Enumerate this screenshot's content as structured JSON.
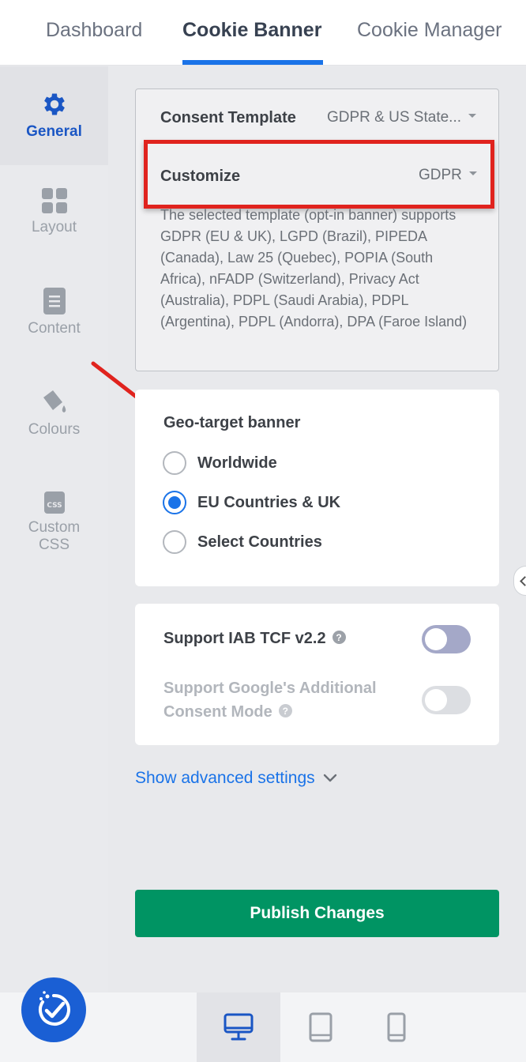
{
  "tabs": [
    {
      "label": "Dashboard",
      "active": false
    },
    {
      "label": "Cookie Banner",
      "active": true
    },
    {
      "label": "Cookie Manager",
      "active": false
    }
  ],
  "sidebar": {
    "items": [
      {
        "label": "General",
        "icon": "gear-icon",
        "active": true
      },
      {
        "label": "Layout",
        "icon": "grid-icon",
        "active": false
      },
      {
        "label": "Content",
        "icon": "document-icon",
        "active": false
      },
      {
        "label": "Colours",
        "icon": "paint-bucket-icon",
        "active": false
      },
      {
        "label": "Custom CSS",
        "icon": "css-file-icon",
        "active": false
      }
    ]
  },
  "template": {
    "consent_label": "Consent Template",
    "consent_value": "GDPR & US State...",
    "customize_label": "Customize",
    "customize_value": "GDPR",
    "description": "The selected template (opt-in banner) supports GDPR (EU & UK), LGPD (Brazil), PIPEDA (Canada), Law 25 (Quebec), POPIA (South Africa), nFADP (Switzerland), Privacy Act (Australia), PDPL (Saudi Arabia), PDPL (Argentina), PDPL (Andorra), DPA (Faroe Island)"
  },
  "geo": {
    "title": "Geo-target banner",
    "options": [
      {
        "label": "Worldwide",
        "checked": false
      },
      {
        "label": "EU Countries & UK",
        "checked": true
      },
      {
        "label": "Select Countries",
        "checked": false
      }
    ]
  },
  "iab": {
    "tcf_label": "Support IAB TCF v2.2",
    "tcf_enabled": true,
    "gcm_label": "Support Google's Additional Consent Mode",
    "gcm_enabled": false
  },
  "advanced_link": "Show advanced settings",
  "publish_label": "Publish Changes",
  "devices": [
    {
      "name": "desktop",
      "active": true
    },
    {
      "name": "tablet",
      "active": false
    },
    {
      "name": "mobile",
      "active": false
    }
  ],
  "colors": {
    "accent": "#1a73e8",
    "publish": "#009463",
    "highlight": "#e0231e"
  }
}
